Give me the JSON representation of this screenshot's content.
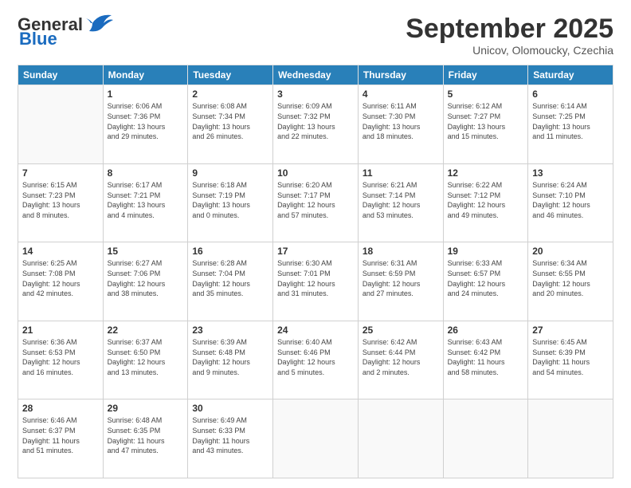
{
  "header": {
    "logo_general": "General",
    "logo_blue": "Blue",
    "month_title": "September 2025",
    "subtitle": "Unicov, Olomoucky, Czechia"
  },
  "days_of_week": [
    "Sunday",
    "Monday",
    "Tuesday",
    "Wednesday",
    "Thursday",
    "Friday",
    "Saturday"
  ],
  "weeks": [
    [
      {
        "day": "",
        "info": ""
      },
      {
        "day": "1",
        "info": "Sunrise: 6:06 AM\nSunset: 7:36 PM\nDaylight: 13 hours\nand 29 minutes."
      },
      {
        "day": "2",
        "info": "Sunrise: 6:08 AM\nSunset: 7:34 PM\nDaylight: 13 hours\nand 26 minutes."
      },
      {
        "day": "3",
        "info": "Sunrise: 6:09 AM\nSunset: 7:32 PM\nDaylight: 13 hours\nand 22 minutes."
      },
      {
        "day": "4",
        "info": "Sunrise: 6:11 AM\nSunset: 7:30 PM\nDaylight: 13 hours\nand 18 minutes."
      },
      {
        "day": "5",
        "info": "Sunrise: 6:12 AM\nSunset: 7:27 PM\nDaylight: 13 hours\nand 15 minutes."
      },
      {
        "day": "6",
        "info": "Sunrise: 6:14 AM\nSunset: 7:25 PM\nDaylight: 13 hours\nand 11 minutes."
      }
    ],
    [
      {
        "day": "7",
        "info": "Sunrise: 6:15 AM\nSunset: 7:23 PM\nDaylight: 13 hours\nand 8 minutes."
      },
      {
        "day": "8",
        "info": "Sunrise: 6:17 AM\nSunset: 7:21 PM\nDaylight: 13 hours\nand 4 minutes."
      },
      {
        "day": "9",
        "info": "Sunrise: 6:18 AM\nSunset: 7:19 PM\nDaylight: 13 hours\nand 0 minutes."
      },
      {
        "day": "10",
        "info": "Sunrise: 6:20 AM\nSunset: 7:17 PM\nDaylight: 12 hours\nand 57 minutes."
      },
      {
        "day": "11",
        "info": "Sunrise: 6:21 AM\nSunset: 7:14 PM\nDaylight: 12 hours\nand 53 minutes."
      },
      {
        "day": "12",
        "info": "Sunrise: 6:22 AM\nSunset: 7:12 PM\nDaylight: 12 hours\nand 49 minutes."
      },
      {
        "day": "13",
        "info": "Sunrise: 6:24 AM\nSunset: 7:10 PM\nDaylight: 12 hours\nand 46 minutes."
      }
    ],
    [
      {
        "day": "14",
        "info": "Sunrise: 6:25 AM\nSunset: 7:08 PM\nDaylight: 12 hours\nand 42 minutes."
      },
      {
        "day": "15",
        "info": "Sunrise: 6:27 AM\nSunset: 7:06 PM\nDaylight: 12 hours\nand 38 minutes."
      },
      {
        "day": "16",
        "info": "Sunrise: 6:28 AM\nSunset: 7:04 PM\nDaylight: 12 hours\nand 35 minutes."
      },
      {
        "day": "17",
        "info": "Sunrise: 6:30 AM\nSunset: 7:01 PM\nDaylight: 12 hours\nand 31 minutes."
      },
      {
        "day": "18",
        "info": "Sunrise: 6:31 AM\nSunset: 6:59 PM\nDaylight: 12 hours\nand 27 minutes."
      },
      {
        "day": "19",
        "info": "Sunrise: 6:33 AM\nSunset: 6:57 PM\nDaylight: 12 hours\nand 24 minutes."
      },
      {
        "day": "20",
        "info": "Sunrise: 6:34 AM\nSunset: 6:55 PM\nDaylight: 12 hours\nand 20 minutes."
      }
    ],
    [
      {
        "day": "21",
        "info": "Sunrise: 6:36 AM\nSunset: 6:53 PM\nDaylight: 12 hours\nand 16 minutes."
      },
      {
        "day": "22",
        "info": "Sunrise: 6:37 AM\nSunset: 6:50 PM\nDaylight: 12 hours\nand 13 minutes."
      },
      {
        "day": "23",
        "info": "Sunrise: 6:39 AM\nSunset: 6:48 PM\nDaylight: 12 hours\nand 9 minutes."
      },
      {
        "day": "24",
        "info": "Sunrise: 6:40 AM\nSunset: 6:46 PM\nDaylight: 12 hours\nand 5 minutes."
      },
      {
        "day": "25",
        "info": "Sunrise: 6:42 AM\nSunset: 6:44 PM\nDaylight: 12 hours\nand 2 minutes."
      },
      {
        "day": "26",
        "info": "Sunrise: 6:43 AM\nSunset: 6:42 PM\nDaylight: 11 hours\nand 58 minutes."
      },
      {
        "day": "27",
        "info": "Sunrise: 6:45 AM\nSunset: 6:39 PM\nDaylight: 11 hours\nand 54 minutes."
      }
    ],
    [
      {
        "day": "28",
        "info": "Sunrise: 6:46 AM\nSunset: 6:37 PM\nDaylight: 11 hours\nand 51 minutes."
      },
      {
        "day": "29",
        "info": "Sunrise: 6:48 AM\nSunset: 6:35 PM\nDaylight: 11 hours\nand 47 minutes."
      },
      {
        "day": "30",
        "info": "Sunrise: 6:49 AM\nSunset: 6:33 PM\nDaylight: 11 hours\nand 43 minutes."
      },
      {
        "day": "",
        "info": ""
      },
      {
        "day": "",
        "info": ""
      },
      {
        "day": "",
        "info": ""
      },
      {
        "day": "",
        "info": ""
      }
    ]
  ]
}
